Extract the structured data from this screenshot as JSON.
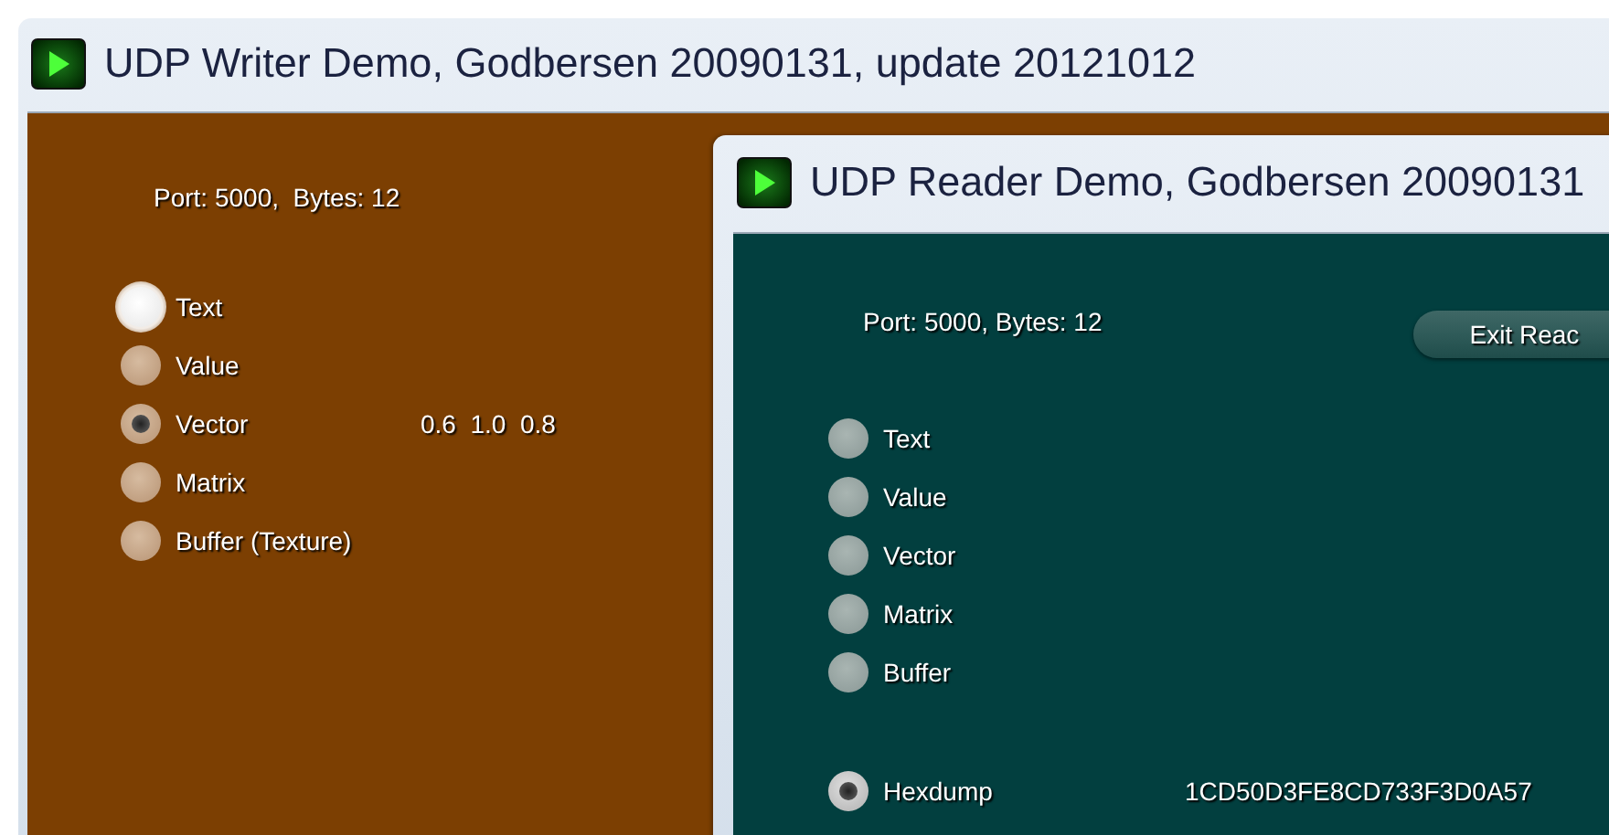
{
  "windows": [
    {
      "kind": "writer",
      "title": "UDP Writer Demo, Godbersen 20090131, update 20121012",
      "status": "Port: 5000,  Bytes: 12",
      "options": [
        {
          "label": "Text",
          "selected": false,
          "highlighted": true
        },
        {
          "label": "Value",
          "selected": false,
          "highlighted": false
        },
        {
          "label": "Vector",
          "selected": true,
          "highlighted": false,
          "value": "0.6  1.0  0.8"
        },
        {
          "label": "Matrix",
          "selected": false,
          "highlighted": false
        },
        {
          "label": "Buffer (Texture)",
          "selected": false,
          "highlighted": false
        }
      ]
    },
    {
      "kind": "reader",
      "title": "UDP Reader Demo, Godbersen 20090131",
      "status": "Port: 5000, Bytes: 12",
      "button": "Exit Reac",
      "options": [
        {
          "label": "Text",
          "selected": false,
          "highlighted": false
        },
        {
          "label": "Value",
          "selected": false,
          "highlighted": false
        },
        {
          "label": "Vector",
          "selected": false,
          "highlighted": false
        },
        {
          "label": "Matrix",
          "selected": false,
          "highlighted": false
        },
        {
          "label": "Buffer",
          "selected": false,
          "highlighted": false
        }
      ],
      "display_options": [
        {
          "label": "Hexdump",
          "selected": true,
          "highlighted": false,
          "value": "1CD50D3FE8CD733F3D0A57"
        }
      ]
    }
  ]
}
